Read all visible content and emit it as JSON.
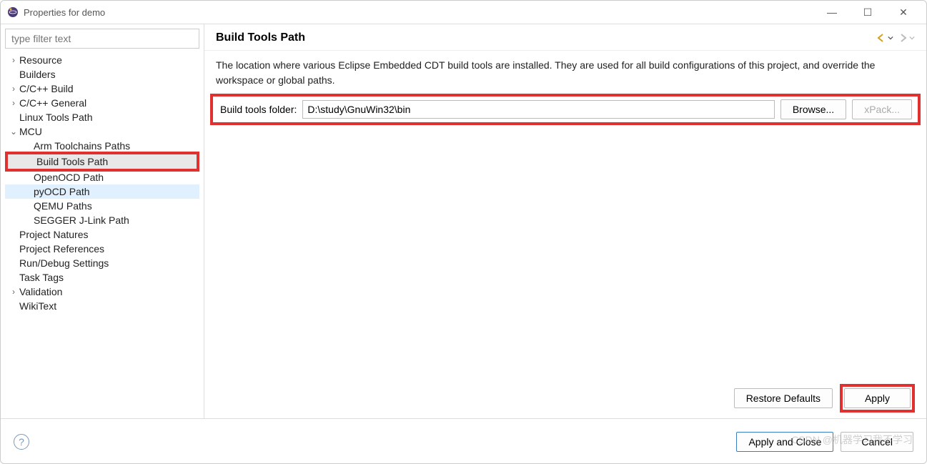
{
  "window": {
    "title": "Properties for demo"
  },
  "sidebar": {
    "filter_placeholder": "type filter text",
    "items": [
      {
        "label": "Resource",
        "level": 1,
        "twisty": ">"
      },
      {
        "label": "Builders",
        "level": 1,
        "twisty": ""
      },
      {
        "label": "C/C++ Build",
        "level": 1,
        "twisty": ">"
      },
      {
        "label": "C/C++ General",
        "level": 1,
        "twisty": ">"
      },
      {
        "label": "Linux Tools Path",
        "level": 1,
        "twisty": ""
      },
      {
        "label": "MCU",
        "level": 1,
        "twisty": "v"
      },
      {
        "label": "Arm Toolchains Paths",
        "level": 2,
        "twisty": ""
      },
      {
        "label": "Build Tools Path",
        "level": 2,
        "twisty": "",
        "selected": true,
        "redbox": true
      },
      {
        "label": "OpenOCD Path",
        "level": 2,
        "twisty": ""
      },
      {
        "label": "pyOCD Path",
        "level": 2,
        "twisty": "",
        "hover": true
      },
      {
        "label": "QEMU Paths",
        "level": 2,
        "twisty": ""
      },
      {
        "label": "SEGGER J-Link Path",
        "level": 2,
        "twisty": ""
      },
      {
        "label": "Project Natures",
        "level": 1,
        "twisty": ""
      },
      {
        "label": "Project References",
        "level": 1,
        "twisty": ""
      },
      {
        "label": "Run/Debug Settings",
        "level": 1,
        "twisty": ""
      },
      {
        "label": "Task Tags",
        "level": 1,
        "twisty": ""
      },
      {
        "label": "Validation",
        "level": 1,
        "twisty": ">"
      },
      {
        "label": "WikiText",
        "level": 1,
        "twisty": ""
      }
    ]
  },
  "content": {
    "heading": "Build Tools Path",
    "description": "The location where various Eclipse Embedded CDT build tools are installed. They are used for all build configurations of this project, and override the workspace or global paths.",
    "field_label": "Build tools folder:",
    "field_value": "D:\\study\\GnuWin32\\bin",
    "browse_label": "Browse...",
    "xpack_label": "xPack...",
    "restore_label": "Restore Defaults",
    "apply_label": "Apply"
  },
  "footer": {
    "apply_close": "Apply and Close",
    "cancel": "Cancel"
  },
  "watermark": "CSDN @机器学习我不学习"
}
